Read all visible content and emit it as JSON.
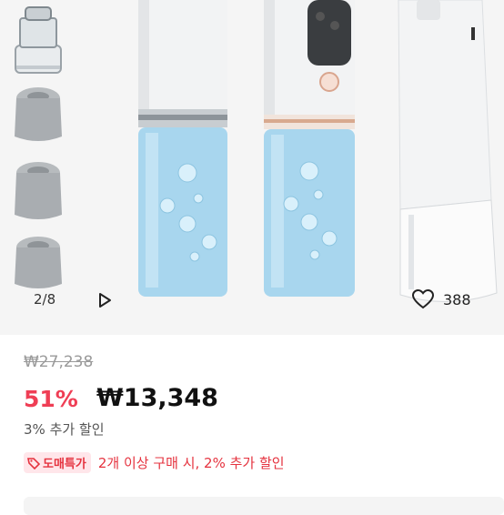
{
  "gallery": {
    "counter": "2/8",
    "like_count": "388",
    "icons": {
      "play": "play-icon",
      "like": "heart-outline-icon"
    }
  },
  "pricing": {
    "original_price": "₩27,238",
    "discount_rate": "51%",
    "sale_price": "₩13,348",
    "extra_discount": "3% 추가 할인"
  },
  "promo": {
    "badge": "도매특가",
    "badge_icon": "tag-icon",
    "text": "2개 이상 구매 시, 2% 추가 할인"
  },
  "colors": {
    "accent": "#ef3e55",
    "badge_bg": "#ffe6ea"
  }
}
